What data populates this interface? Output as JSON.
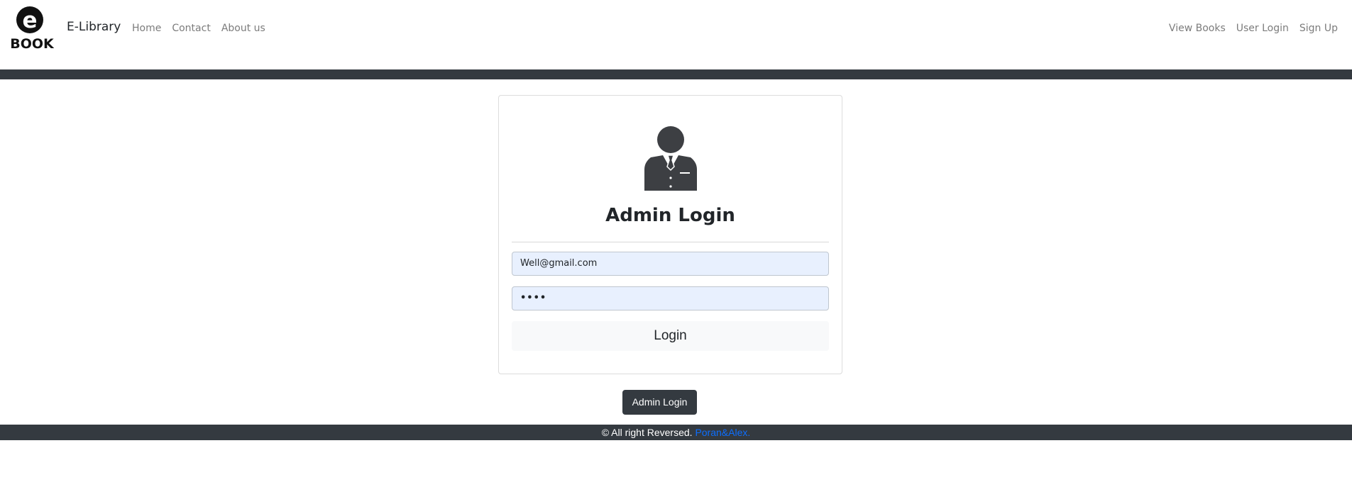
{
  "navbar": {
    "brand": "E-Library",
    "logo_letter": "e",
    "logo_text": "BOOK",
    "left_links": [
      "Home",
      "Contact",
      "About us"
    ],
    "right_links": [
      "View Books",
      "User Login",
      "Sign Up"
    ]
  },
  "card": {
    "icon": "admin-user-icon",
    "title": "Admin Login",
    "email_value": "Well@gmail.com",
    "password_value": "••••",
    "login_label": "Login"
  },
  "admin_button": "Admin Login",
  "footer": {
    "text": "© All right Reversed.",
    "link": "Poran&Alex."
  },
  "colors": {
    "dark_bar": "#343a40",
    "input_bg": "#e8f0fe",
    "link": "#0d6efd"
  }
}
